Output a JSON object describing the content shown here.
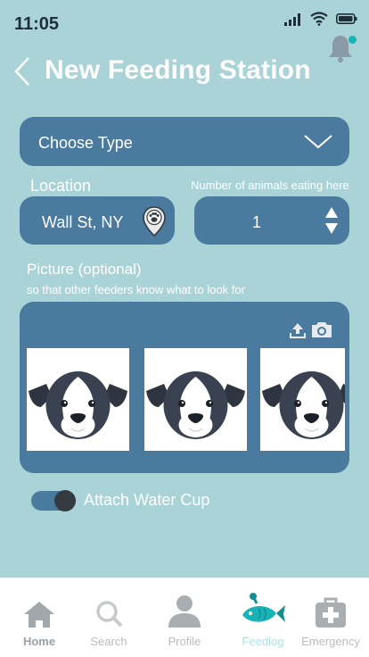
{
  "status": {
    "time": "11:05"
  },
  "header": {
    "title": "New Feeding Station"
  },
  "form": {
    "type_select": {
      "value": "Choose Type"
    },
    "location": {
      "label": "Location",
      "value": "Wall St, NY"
    },
    "animal_count": {
      "label": "Number of animals eating here",
      "value": "1"
    },
    "picture": {
      "label": "Picture (optional)",
      "hint": "so that other feeders know what to look for"
    },
    "water_cup": {
      "label": "Attach Water Cup",
      "enabled": true
    }
  },
  "tabbar": {
    "items": [
      {
        "label": "Home",
        "icon": "home-icon",
        "state": "current"
      },
      {
        "label": "Search",
        "icon": "search-icon"
      },
      {
        "label": "Profile",
        "icon": "profile-icon"
      },
      {
        "label": "Feedlog",
        "icon": "fish-icon"
      },
      {
        "label": "Emergency",
        "icon": "first-aid-icon"
      }
    ]
  },
  "colors": {
    "background": "#a9d3d6",
    "panel": "#4a7b9f",
    "accent": "#18b3b7"
  }
}
